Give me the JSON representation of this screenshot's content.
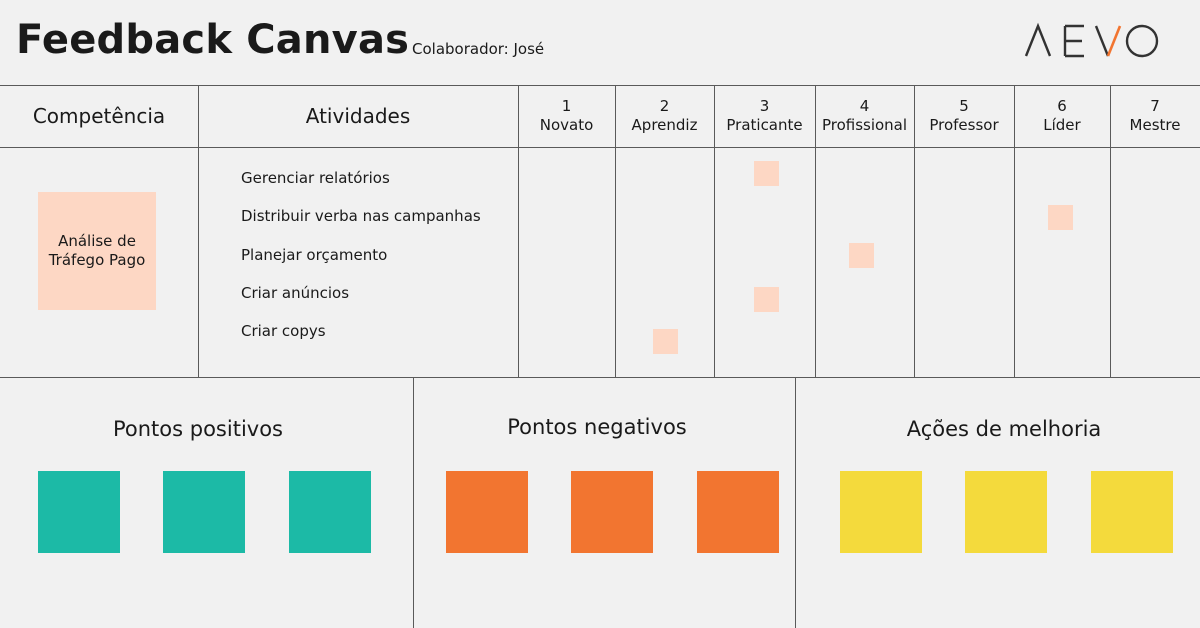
{
  "header": {
    "title": "Feedback Canvas",
    "collaborator": "Colaborador: José",
    "logo_text": "AEVO"
  },
  "table": {
    "competence_header": "Competência",
    "activities_header": "Atividades",
    "levels": [
      {
        "number": "1",
        "name": "Novato"
      },
      {
        "number": "2",
        "name": "Aprendiz"
      },
      {
        "number": "3",
        "name": "Praticante"
      },
      {
        "number": "4",
        "name": "Profissional"
      },
      {
        "number": "5",
        "name": "Professor"
      },
      {
        "number": "6",
        "name": "Líder"
      },
      {
        "number": "7",
        "name": "Mestre"
      }
    ],
    "competence": "Análise de Tráfego Pago",
    "activities": [
      {
        "label": "Gerenciar relatórios",
        "level": 3
      },
      {
        "label": "Distribuir verba nas campanhas",
        "level": 6
      },
      {
        "label": "Planejar orçamento",
        "level": 4
      },
      {
        "label": "Criar anúncios",
        "level": 3
      },
      {
        "label": "Criar copys",
        "level": 2
      }
    ]
  },
  "sections": [
    {
      "title": "Pontos positivos",
      "color": "#1cbaa6",
      "notes": 3
    },
    {
      "title": "Pontos negativos",
      "color": "#f27530",
      "notes": 3
    },
    {
      "title": "Ações de melhoria",
      "color": "#f4da3c",
      "notes": 3
    }
  ],
  "colors": {
    "sticky_note_peach": "#fdd7c4",
    "line": "#5a5a5a",
    "background": "#f1f1f1"
  }
}
